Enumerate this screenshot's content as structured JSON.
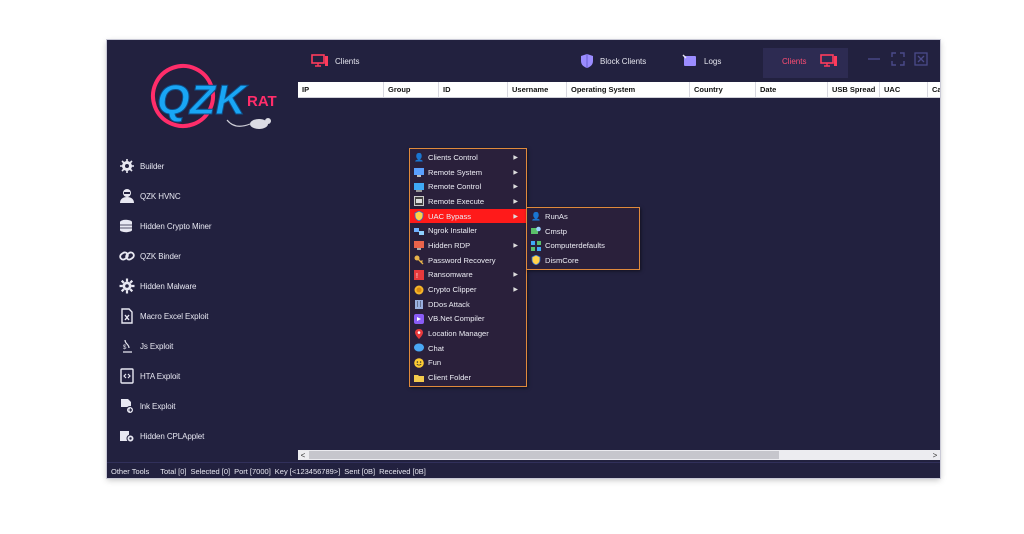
{
  "app": {
    "logo_text": "QZK",
    "logo_sub": "RAT"
  },
  "sidebar": {
    "items": [
      {
        "label": "Builder",
        "icon": "gear-bug-icon"
      },
      {
        "label": "QZK HVNC",
        "icon": "hacker-icon"
      },
      {
        "label": "Hidden Crypto Miner",
        "icon": "coins-icon"
      },
      {
        "label": "QZK Binder",
        "icon": "link-icon"
      },
      {
        "label": "Hidden Malware",
        "icon": "cog-icon"
      },
      {
        "label": "Macro Excel Exploit",
        "icon": "excel-file-icon"
      },
      {
        "label": "Js Exploit",
        "icon": "js-icon"
      },
      {
        "label": "HTA Exploit",
        "icon": "code-file-icon"
      },
      {
        "label": "lnk Exploit",
        "icon": "shortcut-file-icon"
      },
      {
        "label": "Hidden CPLApplet",
        "icon": "applet-icon"
      }
    ]
  },
  "topbar": {
    "clients_label": "Clients",
    "block_clients_label": "Block Clients",
    "logs_label": "Logs",
    "active_clients_label": "Clients"
  },
  "table": {
    "columns": [
      "IP",
      "Group",
      "ID",
      "Username",
      "Operating System",
      "Country",
      "Date",
      "USB Spread",
      "UAC",
      "Ca"
    ]
  },
  "context_menu": {
    "items": [
      {
        "label": "Clients Control",
        "icon": "person-icon",
        "submenu": true
      },
      {
        "label": "Remote System",
        "icon": "system-icon",
        "submenu": true
      },
      {
        "label": "Remote Control",
        "icon": "monitor-icon",
        "submenu": true
      },
      {
        "label": "Remote Execute",
        "icon": "window-icon",
        "submenu": true
      },
      {
        "label": "UAC Bypass",
        "icon": "shield-icon",
        "submenu": true,
        "selected": true
      },
      {
        "label": "Ngrok Installer",
        "icon": "network-icon",
        "submenu": false
      },
      {
        "label": "Hidden RDP",
        "icon": "rdp-icon",
        "submenu": true
      },
      {
        "label": "Password Recovery",
        "icon": "key-icon",
        "submenu": false
      },
      {
        "label": "Ransomware",
        "icon": "ransom-icon",
        "submenu": true
      },
      {
        "label": "Crypto Clipper",
        "icon": "coin-icon",
        "submenu": true
      },
      {
        "label": "DDos Attack",
        "icon": "building-icon",
        "submenu": false
      },
      {
        "label": "VB.Net Compiler",
        "icon": "vs-icon",
        "submenu": false
      },
      {
        "label": "Location Manager",
        "icon": "pin-icon",
        "submenu": false
      },
      {
        "label": "Chat",
        "icon": "chat-icon",
        "submenu": false
      },
      {
        "label": "Fun",
        "icon": "smile-icon",
        "submenu": false
      },
      {
        "label": "Client Folder",
        "icon": "folder-icon",
        "submenu": false
      }
    ]
  },
  "submenu": {
    "items": [
      {
        "label": "RunAs",
        "icon": "runas-icon"
      },
      {
        "label": "Cmstp",
        "icon": "cmstp-icon"
      },
      {
        "label": "Computerdefaults",
        "icon": "defaults-icon"
      },
      {
        "label": "DismCore",
        "icon": "dism-icon"
      }
    ]
  },
  "status": {
    "other_tools": "Other Tools",
    "total": "Total [0]",
    "selected": "Selected [0]",
    "port": "Port [7000]",
    "key": "Key [<123456789>]",
    "sent": "Sent [0B]",
    "received": "Received [0B]"
  },
  "colors": {
    "background": "#22213f",
    "accent_red": "#ff1a1a",
    "logo_blue": "#19a6f5",
    "logo_pink": "#ff2d6a",
    "menu_border": "#e08a3c",
    "menu_bg": "#2a203b"
  }
}
